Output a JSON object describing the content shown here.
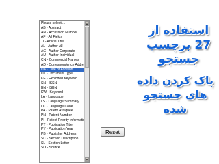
{
  "field_select": {
    "selected_index": 10,
    "options": [
      "Please select ...",
      "AB - Abstract",
      "AN - Accession Number",
      "AF - All Fields",
      "TI - Article Title",
      "AL - Author All",
      "AC - Author Corporate",
      "AU - Author Individual",
      "CN - Commercial Names",
      "AD - Correspondence Address",
      "DA - Date of Addition",
      "DT - Document Type",
      "KE - Exploded Keyword",
      "SN - ISSN",
      "BN - ISBN",
      "KW - Keyword",
      "LA - Language",
      "LS - Language Summary",
      "LC - Language Code",
      "PA - Patent Assignee",
      "PN - Patent Number",
      "PI - Patent Priority Information",
      "PT - Publication Title",
      "PY - Publication Year",
      "PB - Publisher Address",
      "SC - Section Description",
      "SL - Section Letter",
      "SO - Source"
    ]
  },
  "reset_button": {
    "label": "Reset"
  },
  "callouts": {
    "use_as_field": [
      "استفاده از",
      "27 برچسب",
      "جستجو"
    ],
    "clear_search": [
      "پاک کردن داده",
      "های جستجو",
      "شده"
    ]
  },
  "colors": {
    "callout_text": "#1565d8",
    "selection": "#316ac5"
  }
}
